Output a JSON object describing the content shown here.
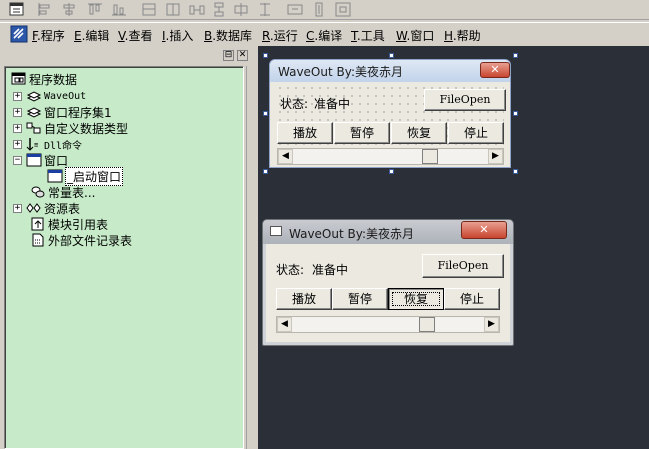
{
  "toolbar": {
    "buttons": [
      "align-left-icon",
      "align-center-icon",
      "align-top-icon",
      "align-bottom-icon",
      "same-width-icon",
      "same-height-icon",
      "distribute-horizontal-icon",
      "distribute-vertical-icon",
      "center-horizontal-icon",
      "center-vertical-icon",
      "grid-icon"
    ]
  },
  "menubar": {
    "items": [
      {
        "key": "F",
        "label": ".程序"
      },
      {
        "key": "E",
        "label": ".编辑"
      },
      {
        "key": "V",
        "label": ".查看"
      },
      {
        "key": "I",
        "label": ".插入"
      },
      {
        "key": "B",
        "label": ".数据库"
      },
      {
        "key": "R",
        "label": ".运行"
      },
      {
        "key": "C",
        "label": ".编译"
      },
      {
        "key": "T",
        "label": ".工具"
      },
      {
        "key": "W",
        "label": ".窗口"
      },
      {
        "key": "H",
        "label": ".帮助"
      }
    ]
  },
  "panel": {
    "pin_glyph": "⊟",
    "close_glyph": "✕"
  },
  "tree": {
    "root": "程序数据",
    "items": [
      {
        "label": "WaveOut",
        "expander": "+"
      },
      {
        "label": "窗口程序集1",
        "expander": "+"
      },
      {
        "label": "自定义数据类型",
        "expander": "+"
      },
      {
        "label": "Dll命令",
        "expander": "+"
      },
      {
        "label": "窗口",
        "expander": "−"
      },
      {
        "label": "_启动窗口",
        "expander": ""
      },
      {
        "label": "常量表...",
        "expander": ""
      },
      {
        "label": "资源表",
        "expander": "+"
      },
      {
        "label": "模块引用表",
        "expander": ""
      },
      {
        "label": "外部文件记录表",
        "expander": ""
      }
    ]
  },
  "design_form": {
    "title": "WaveOut By:美夜赤月",
    "close": "✕",
    "status_label": "状态:",
    "status_value": "准备中",
    "fileopen": "FileOpen",
    "play": "播放",
    "pause": "暂停",
    "resume": "恢复",
    "stop": "停止",
    "scroll_left": "◀",
    "scroll_right": "▶",
    "slider_position": 0.72
  },
  "runtime_window": {
    "title": "WaveOut By:美夜赤月",
    "close": "✕",
    "status_label": "状态:",
    "status_value": "准备中",
    "fileopen": "FileOpen",
    "play": "播放",
    "pause": "暂停",
    "resume": "恢复",
    "stop": "停止",
    "scroll_left": "◀",
    "scroll_right": "▶",
    "slider_position": 0.72
  }
}
